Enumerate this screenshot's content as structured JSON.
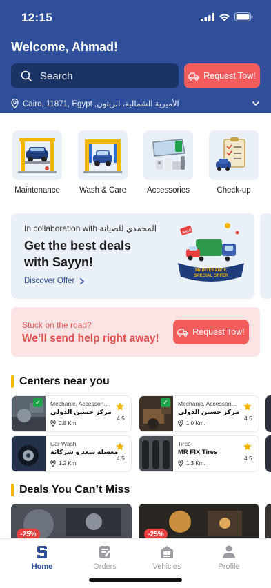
{
  "status_bar": {
    "time": "12:15"
  },
  "header": {
    "welcome": "Welcome, Ahmad!",
    "search_placeholder": "Search",
    "request_tow_label": "Request Tow!",
    "location": "Cairo, 11871, Egypt ,الأميرية الشمالية، الزيتون"
  },
  "categories": [
    {
      "label": "Maintenance",
      "icon": "car-lift-icon"
    },
    {
      "label": "Wash & Care",
      "icon": "car-wash-icon"
    },
    {
      "label": "Accessories",
      "icon": "accessories-icon"
    },
    {
      "label": "Check-up",
      "icon": "checklist-icon"
    }
  ],
  "promo": {
    "collab_prefix": "In collaboration with",
    "collab_partner": "المحمدي للصيانة",
    "title_line1": "Get the best deals",
    "title_line2": "with Sayyn!",
    "link": "Discover Offer",
    "art_ribbon_line1": "MAINTENANCE",
    "art_ribbon_line2": "SPECIAL OFFER",
    "art_tag": "SALE"
  },
  "help": {
    "question": "Stuck on the road?",
    "title": "We’ll send help right away!",
    "button": "Request Tow!"
  },
  "centers": {
    "title": "Centers near you",
    "items": [
      {
        "category": "Mechanic, Accessori...",
        "name": "مركز حسين الدولي",
        "distance": "0.8 Km.",
        "rating": "4.5",
        "badge": true
      },
      {
        "category": "Mechanic, Accessori...",
        "name": "مركز حسين الدولي",
        "distance": "1.0 Km.",
        "rating": "4.5",
        "badge": true
      },
      {
        "category": "Car Wash",
        "name": "مغسلة سعد و شركائة",
        "distance": "1.2 Km.",
        "rating": "4.5",
        "badge": false
      },
      {
        "category": "Tires",
        "name": "MR FIX Tires",
        "distance": "1.3 Km.",
        "rating": "4.5",
        "badge": false
      }
    ]
  },
  "deals": {
    "title": "Deals You Can’t Miss",
    "items": [
      {
        "discount": "-25%"
      },
      {
        "discount": "-25%"
      }
    ]
  },
  "tabs": [
    {
      "label": "Home",
      "icon": "home-icon",
      "active": true
    },
    {
      "label": "Orders",
      "icon": "orders-icon",
      "active": false
    },
    {
      "label": "Vehicles",
      "icon": "garage-icon",
      "active": false
    },
    {
      "label": "Profile",
      "icon": "profile-icon",
      "active": false
    }
  ],
  "colors": {
    "primary": "#2f4f9a",
    "accent_red": "#f25c5c",
    "highlight_yellow": "#f4b400",
    "card_blue": "#eaf0f7",
    "card_pink": "#fde4e4"
  }
}
